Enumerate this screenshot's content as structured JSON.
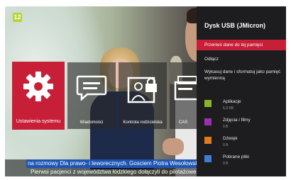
{
  "channel": {
    "logo_text": "12"
  },
  "apps": [
    {
      "label": "Ustawienia systemu",
      "icon": "gear-icon",
      "selected": true
    },
    {
      "label": "Wiadomości",
      "icon": "message-bubble-icon",
      "selected": false
    },
    {
      "label": "Kontrola rodzicielska",
      "icon": "parental-lock-icon",
      "selected": false
    },
    {
      "label": "CAS",
      "icon": "card-reader-icon",
      "selected": false
    }
  ],
  "ticker": {
    "line1": "na rozmowy Dla prawo- i leworecznych. Gosciem Piotra Wesołowskiego",
    "line2": "Pierwsi pacjenci z województwa łódzkiego dołączyli do pilotażowego"
  },
  "panel": {
    "title": "Dysk USB (JMicron)",
    "transfer_label": "Przenieś dane do tej pamięci",
    "disconnect_label": "Odłącz",
    "format_label": "Wykasuj dane i sformatuj jako pamięć wymienną",
    "storage": [
      {
        "name": "Aplikacje",
        "size": "6,3 KB",
        "color": "#8bb528"
      },
      {
        "name": "Zdjęcia i filmy",
        "size": "0 B",
        "color": "#9c2fb0"
      },
      {
        "name": "Dźwięk",
        "size": "0 B",
        "color": "#e07a1f"
      },
      {
        "name": "Pobrane pliki",
        "size": "0 B",
        "color": "#3f7cd6"
      }
    ]
  },
  "colors": {
    "accent": "#c81f38",
    "panel_bg": "#1d1d1f",
    "ticker_blue": "#1e55b3"
  }
}
